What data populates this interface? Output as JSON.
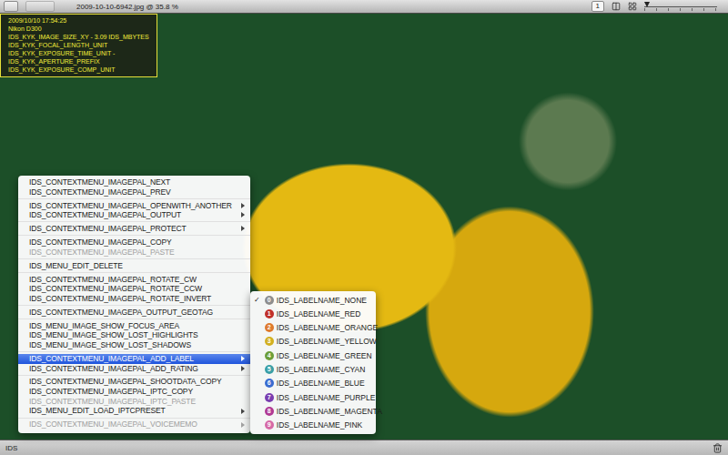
{
  "window": {
    "title": "2009-10-10-6942.jpg @ 35.8 %"
  },
  "toolbar": {
    "page_button": "1",
    "zoom": {
      "level": 0.04
    }
  },
  "info_overlay": {
    "lines": [
      "2009/10/10 17:54:25",
      "Nikon D300",
      "IDS_KYK_IMAGE_SIZE_XY - 3.09 IDS_MBYTES",
      "IDS_KYK_FOCAL_LENGTH_UNIT",
      "IDS_KYK_EXPOSURE_TIME_UNIT -",
      "IDS_KYK_APERTURE_PREFIX",
      "IDS_KYK_EXPOSURE_COMP_UNIT"
    ]
  },
  "context_menu": {
    "groups": [
      [
        {
          "label": "IDS_CONTEXTMENU_IMAGEPAL_NEXT",
          "disabled": false,
          "has_submenu": false,
          "selected": false
        },
        {
          "label": "IDS_CONTEXTMENU_IMAGEPAL_PREV",
          "disabled": false,
          "has_submenu": false,
          "selected": false
        }
      ],
      [
        {
          "label": "IDS_CONTEXTMENU_IMAGEPAL_OPENWITH_ANOTHER",
          "disabled": false,
          "has_submenu": true,
          "selected": false
        },
        {
          "label": "IDS_CONTEXTMENU_IMAGEPAL_OUTPUT",
          "disabled": false,
          "has_submenu": true,
          "selected": false
        }
      ],
      [
        {
          "label": "IDS_CONTEXTMENU_IMAGEPAL_PROTECT",
          "disabled": false,
          "has_submenu": true,
          "selected": false
        }
      ],
      [
        {
          "label": "IDS_CONTEXTMENU_IMAGEPAL_COPY",
          "disabled": false,
          "has_submenu": false,
          "selected": false
        },
        {
          "label": "IDS_CONTEXTMENU_IMAGEPAL_PASTE",
          "disabled": true,
          "has_submenu": false,
          "selected": false
        }
      ],
      [
        {
          "label": "IDS_MENU_EDIT_DELETE",
          "disabled": false,
          "has_submenu": false,
          "selected": false
        }
      ],
      [
        {
          "label": "IDS_CONTEXTMENU_IMAGEPAL_ROTATE_CW",
          "disabled": false,
          "has_submenu": false,
          "selected": false
        },
        {
          "label": "IDS_CONTEXTMENU_IMAGEPAL_ROTATE_CCW",
          "disabled": false,
          "has_submenu": false,
          "selected": false
        },
        {
          "label": "IDS_CONTEXTMENU_IMAGEPAL_ROTATE_INVERT",
          "disabled": false,
          "has_submenu": false,
          "selected": false
        }
      ],
      [
        {
          "label": "IDS_CONTEXTMENU_IMAGEPA_OUTPUT_GEOTAG",
          "disabled": false,
          "has_submenu": false,
          "selected": false
        }
      ],
      [
        {
          "label": "IDS_MENU_IMAGE_SHOW_FOCUS_AREA",
          "disabled": false,
          "has_submenu": false,
          "selected": false
        },
        {
          "label": "IDS_MENU_IMAGE_SHOW_LOST_HIGHLIGHTS",
          "disabled": false,
          "has_submenu": false,
          "selected": false
        },
        {
          "label": "IDS_MENU_IMAGE_SHOW_LOST_SHADOWS",
          "disabled": false,
          "has_submenu": false,
          "selected": false
        }
      ],
      [
        {
          "label": "IDS_CONTEXTMENU_IMAGEPAL_ADD_LABEL",
          "disabled": false,
          "has_submenu": true,
          "selected": true
        },
        {
          "label": "IDS_CONTEXTMENU_IMAGEPAL_ADD_RATING",
          "disabled": false,
          "has_submenu": true,
          "selected": false
        }
      ],
      [
        {
          "label": "IDS_CONTEXTMENU_IMAGEPAL_SHOOTDATA_COPY",
          "disabled": false,
          "has_submenu": false,
          "selected": false
        },
        {
          "label": "IDS_CONTEXTMENU_IMAGEPAL_IPTC_COPY",
          "disabled": false,
          "has_submenu": false,
          "selected": false
        },
        {
          "label": "IDS_CONTEXTMENU_IMAGEPAL_IPTC_PASTE",
          "disabled": true,
          "has_submenu": false,
          "selected": false
        },
        {
          "label": "IDS_MENU_EDIT_LOAD_IPTCPRESET",
          "disabled": false,
          "has_submenu": true,
          "selected": false
        }
      ],
      [
        {
          "label": "IDS_CONTEXTMENU_IMAGEPAL_VOICEMEMO",
          "disabled": true,
          "has_submenu": true,
          "selected": false
        }
      ]
    ]
  },
  "label_submenu": {
    "check_mark": "✓",
    "items": [
      {
        "number": "0",
        "label": "IDS_LABELNAME_NONE",
        "checked": true,
        "color": "#8e8e8e"
      },
      {
        "number": "1",
        "label": "IDS_LABELNAME_RED",
        "checked": false,
        "color": "#c0302a"
      },
      {
        "number": "2",
        "label": "IDS_LABELNAME_ORANGE",
        "checked": false,
        "color": "#de7a2c"
      },
      {
        "number": "3",
        "label": "IDS_LABELNAME_YELLOW",
        "checked": false,
        "color": "#d2b020"
      },
      {
        "number": "4",
        "label": "IDS_LABELNAME_GREEN",
        "checked": false,
        "color": "#6c9e38"
      },
      {
        "number": "5",
        "label": "IDS_LABELNAME_CYAN",
        "checked": false,
        "color": "#3a9fa6"
      },
      {
        "number": "6",
        "label": "IDS_LABELNAME_BLUE",
        "checked": false,
        "color": "#3a6cd0"
      },
      {
        "number": "7",
        "label": "IDS_LABELNAME_PURPLE",
        "checked": false,
        "color": "#7a3eb0"
      },
      {
        "number": "8",
        "label": "IDS_LABELNAME_MAGENTA",
        "checked": false,
        "color": "#b03a94"
      },
      {
        "number": "9",
        "label": "IDS_LABELNAME_PINK",
        "checked": false,
        "color": "#d66aa6"
      }
    ]
  },
  "status_bar": {
    "text": "IDS"
  }
}
